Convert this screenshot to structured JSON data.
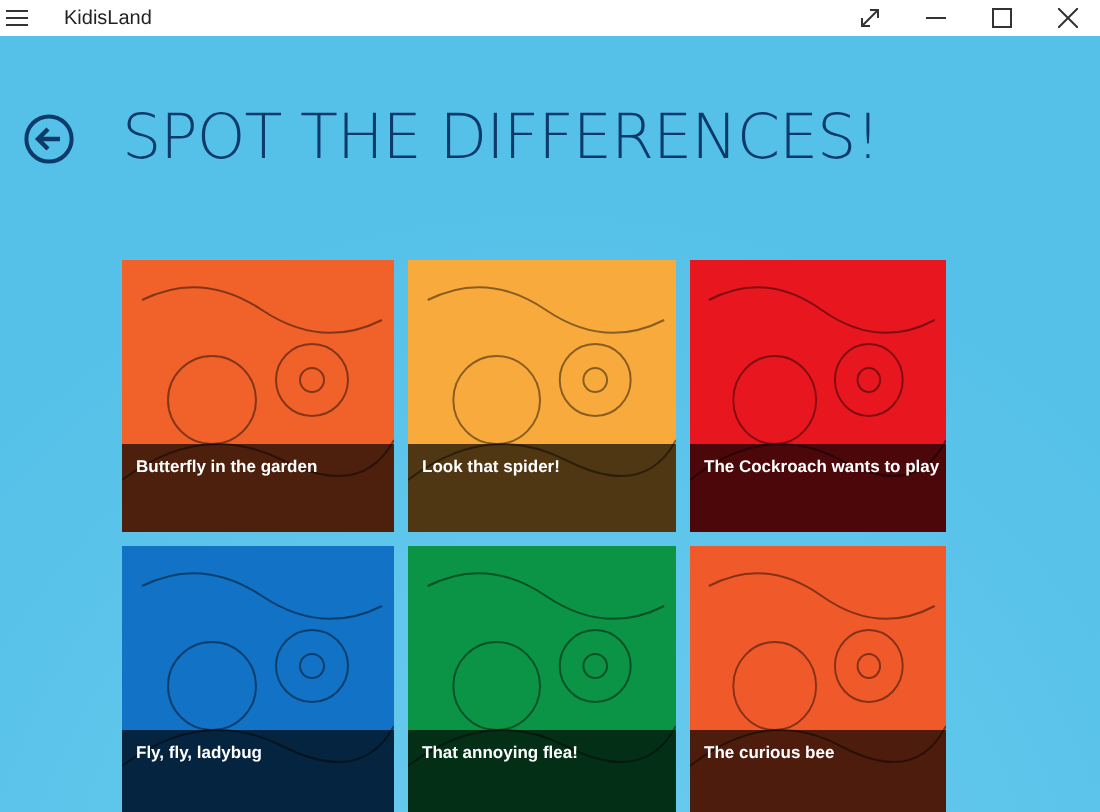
{
  "window": {
    "title": "KidisLand"
  },
  "page": {
    "title": "SPOT THE DIFFERENCES!"
  },
  "tiles": [
    {
      "caption": "Butterfly in the garden",
      "color": "#f0622a"
    },
    {
      "caption": "Look that spider!",
      "color": "#f8aa3c"
    },
    {
      "caption": "The Cockroach wants to play",
      "color": "#e8161f"
    },
    {
      "caption": "Fly, fly, ladybug",
      "color": "#1272c6"
    },
    {
      "caption": "That annoying flea!",
      "color": "#0b9446"
    },
    {
      "caption": "The curious bee",
      "color": "#f0592a"
    }
  ]
}
